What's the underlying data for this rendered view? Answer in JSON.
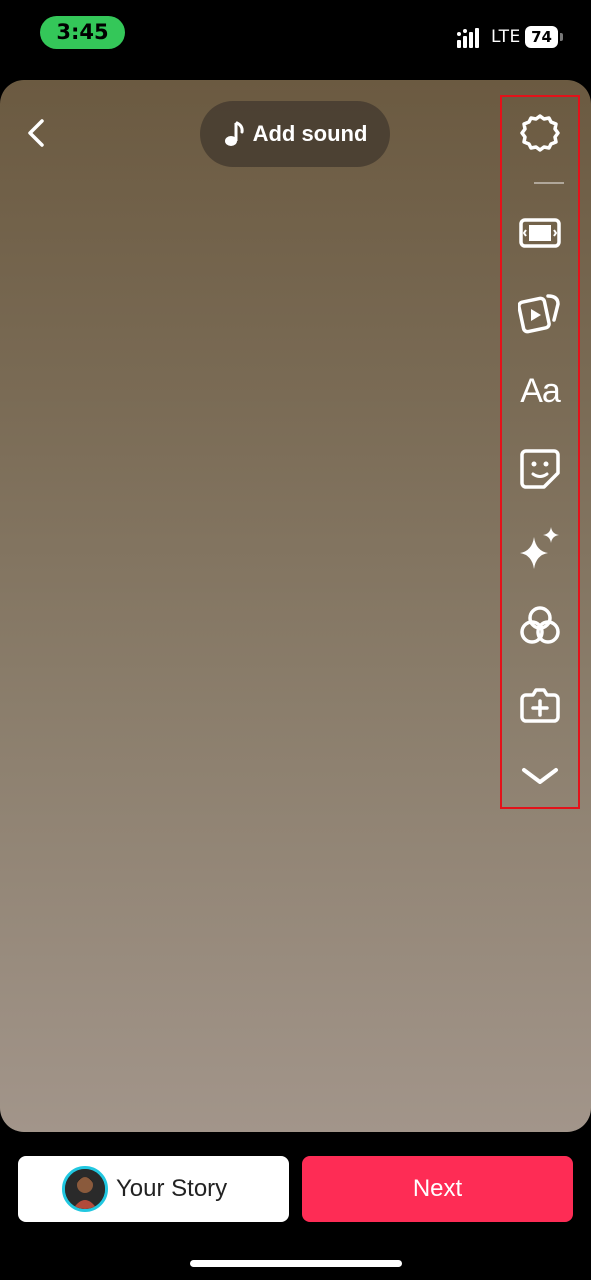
{
  "status_bar": {
    "time": "3:45",
    "carrier": "LTE",
    "battery": "74"
  },
  "top": {
    "back_icon": "chevron-left-icon",
    "add_sound_label": "Add sound",
    "add_sound_icon": "music-note-icon"
  },
  "toolbar": {
    "items": [
      {
        "name": "settings",
        "icon": "gear-icon"
      },
      {
        "name": "adjust-clips",
        "icon": "crop-frame-icon"
      },
      {
        "name": "templates",
        "icon": "video-card-icon"
      },
      {
        "name": "text",
        "icon": "text-icon",
        "label": "Aa"
      },
      {
        "name": "stickers",
        "icon": "sticker-icon"
      },
      {
        "name": "effects",
        "icon": "sparkles-icon"
      },
      {
        "name": "filters",
        "icon": "filter-circles-icon"
      },
      {
        "name": "add-yours",
        "icon": "camera-plus-icon"
      },
      {
        "name": "more",
        "icon": "chevron-down-icon"
      }
    ],
    "highlight_color": "#e3121a"
  },
  "bottom": {
    "your_story_label": "Your Story",
    "next_label": "Next",
    "next_color": "#fe2c55",
    "avatar_ring_color": "#21c7e0"
  }
}
